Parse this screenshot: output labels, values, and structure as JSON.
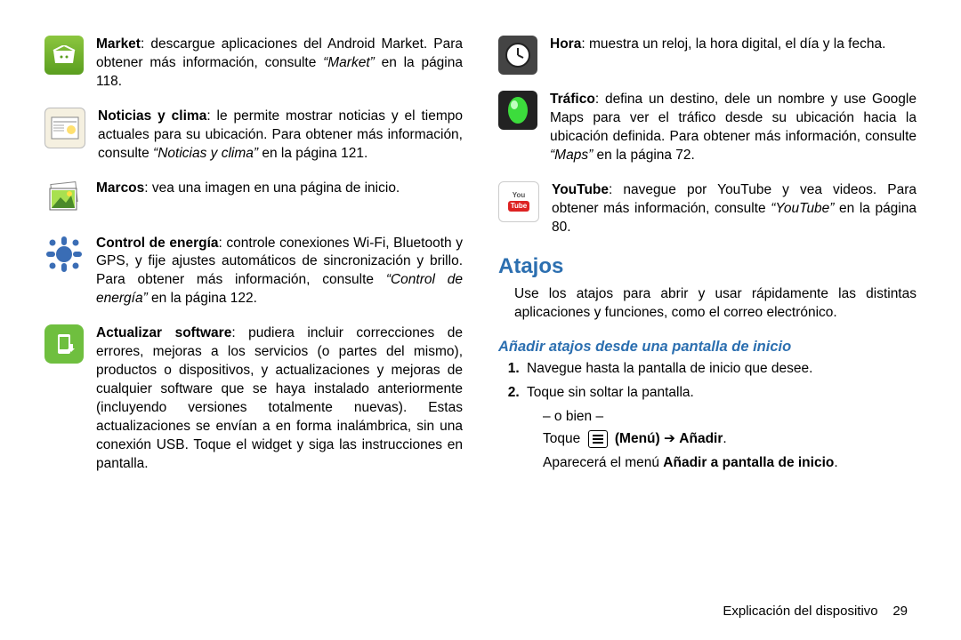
{
  "colors": {
    "section_heading": "#2c6fb0",
    "subsection_heading": "#2c6fb0"
  },
  "left_entries": [
    {
      "icon": "market",
      "title": "Market",
      "body": ": descargue aplicaciones del Android Market. Para obtener más información, consulte ",
      "ref": "“Market”",
      "tail": " en la página 118."
    },
    {
      "icon": "news",
      "title": "Noticias y clima",
      "body": ": le permite mostrar noticias y el tiempo actuales para su ubicación. Para obtener más información, consulte ",
      "ref": "“Noticias y clima”",
      "tail": " en la página 121."
    },
    {
      "icon": "frames",
      "title": "Marcos",
      "body": ": vea una imagen en una página de inicio.",
      "ref": "",
      "tail": ""
    },
    {
      "icon": "power",
      "title": "Control de energía",
      "body": ": controle conexiones Wi-Fi, Bluetooth y GPS, y fije ajustes automáticos de sincronización y brillo. Para obtener más información, consulte ",
      "ref": "“Control de energía”",
      "tail": " en la página 122."
    },
    {
      "icon": "update",
      "title": "Actualizar software",
      "body": ": pudiera incluir correcciones de errores, mejoras a los servicios (o partes del mismo), productos o dispositivos, y actualizaciones y mejoras de cualquier software que se haya instalado anteriormente (incluyendo versiones totalmente nuevas). Estas actualizaciones se envían a en forma inalámbrica, sin una conexión USB. Toque el widget y siga las instrucciones en pantalla.",
      "ref": "",
      "tail": ""
    }
  ],
  "right_entries": [
    {
      "icon": "clock",
      "title": "Hora",
      "body": ": muestra un reloj, la hora digital, el día y la fecha.",
      "ref": "",
      "tail": ""
    },
    {
      "icon": "traffic",
      "title": "Tráfico",
      "body": ": defina un destino, dele un nombre y use Google Maps para ver el tráfico desde su ubicación hacia la ubicación definida. Para obtener más información, consulte ",
      "ref": "“Maps”",
      "tail": " en la página 72."
    },
    {
      "icon": "youtube",
      "title": "YouTube",
      "body": ": navegue por YouTube y vea videos. Para obtener más información, consulte ",
      "ref": "“YouTube”",
      "tail": " en la página 80."
    }
  ],
  "shortcuts": {
    "heading": "Atajos",
    "intro": "Use los atajos para abrir y usar rápidamente las distintas aplicaciones y funciones, como el correo electrónico.",
    "sub": "Añadir atajos desde una pantalla de inicio",
    "step1": "Navegue hasta la pantalla de inicio que desee.",
    "step2": "Toque sin soltar la pantalla.",
    "or": "– o bien –",
    "touch_prefix": "Toque ",
    "menu_label": "Menú",
    "arrow": " ➔ ",
    "add_label": "Añadir",
    "period": ".",
    "result_prefix": "Aparecerá el menú ",
    "result_bold": "Añadir a pantalla de inicio",
    "result_suffix": "."
  },
  "footer": {
    "chapter": "Explicación del dispositivo",
    "page": "29"
  }
}
